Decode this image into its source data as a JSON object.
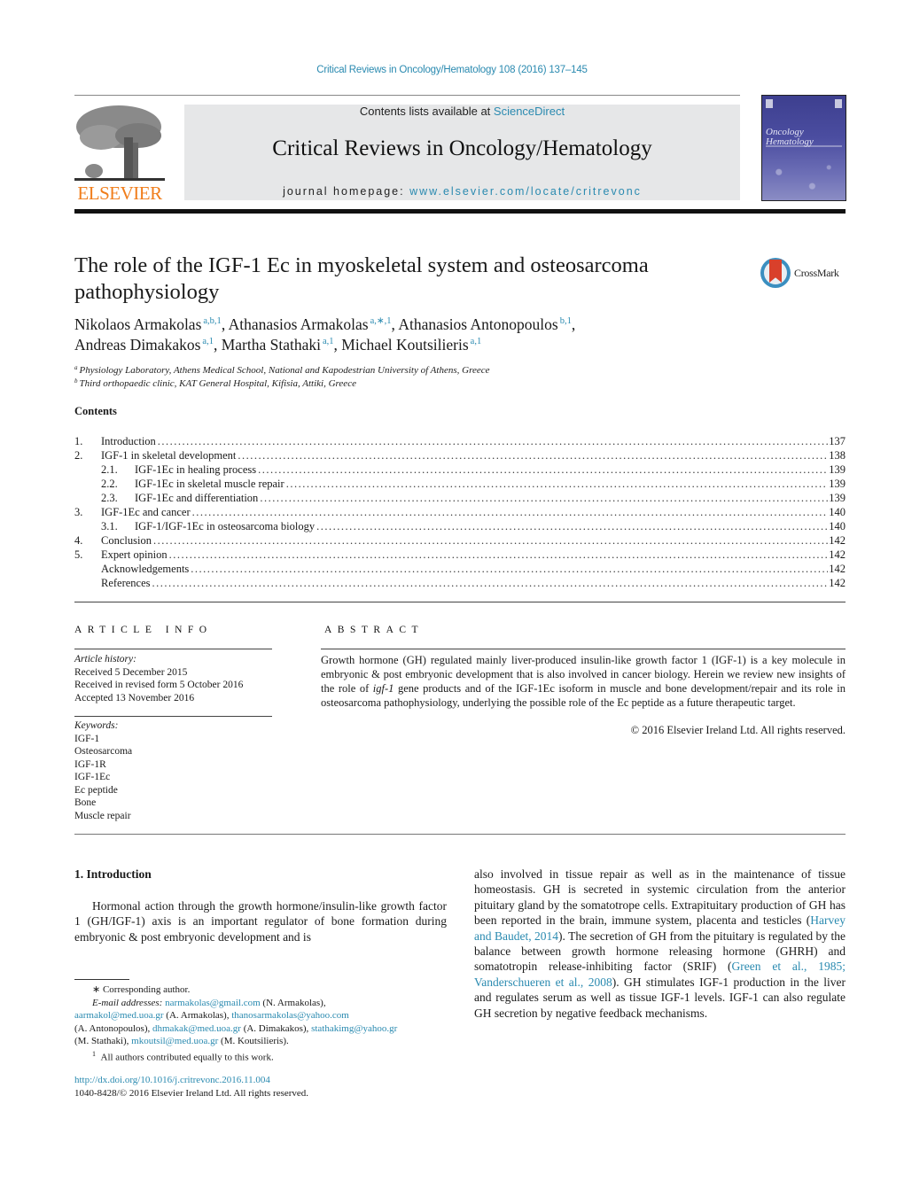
{
  "header": {
    "citation": "Critical Reviews in Oncology/Hematology 108 (2016) 137–145",
    "publisher_logo_text": "ELSEVIER",
    "contents_prefix": "Contents lists available at ",
    "contents_link": "ScienceDirect",
    "journal_title": "Critical Reviews in Oncology/Hematology",
    "homepage_prefix": "journal homepage: ",
    "homepage_link": "www.elsevier.com/locate/critrevonc",
    "cover_title": "Oncology Hematology",
    "colors": {
      "link": "#2a8ab0",
      "elsevier_orange": "#f07d1b",
      "banner_bg": "#e6e7e8",
      "cover": "#4b4da0"
    }
  },
  "article": {
    "title": "The role of the IGF-1 Ec in myoskeletal system and osteosarcoma pathophysiology",
    "crossmark_label": "CrossMark",
    "authors": [
      {
        "name": "Nikolaos Armakolas",
        "sup": "a,b,1",
        "sep": ", "
      },
      {
        "name": "Athanasios Armakolas",
        "sup": "a,∗,1",
        "sep": ", "
      },
      {
        "name": "Athanasios Antonopoulos",
        "sup": "b,1",
        "sep": ","
      },
      {
        "name": "Andreas Dimakakos",
        "sup": "a,1",
        "sep": ", "
      },
      {
        "name": "Martha Stathaki",
        "sup": "a,1",
        "sep": ", "
      },
      {
        "name": "Michael Koutsilieris",
        "sup": "a,1",
        "sep": ""
      }
    ],
    "affiliations": [
      {
        "mark": "a",
        "text": "Physiology Laboratory, Athens Medical School, National and Kapodestrian University of Athens, Greece"
      },
      {
        "mark": "b",
        "text": "Third orthopaedic clinic, KAT General Hospital, Kifisia, Attiki, Greece"
      }
    ]
  },
  "contents": {
    "heading": "Contents",
    "items": [
      {
        "num": "1.",
        "label": "Introduction",
        "page": "137",
        "level": 1
      },
      {
        "num": "2.",
        "label": "IGF-1 in skeletal development",
        "page": "138",
        "level": 1
      },
      {
        "num": "2.1.",
        "label": "IGF-1Ec in healing process",
        "page": "139",
        "level": 2
      },
      {
        "num": "2.2.",
        "label": "IGF-1Ec in skeletal muscle repair",
        "page": "139",
        "level": 2
      },
      {
        "num": "2.3.",
        "label": "IGF-1Ec and differentiation",
        "page": "139",
        "level": 2
      },
      {
        "num": "3.",
        "label": "IGF-1Ec and cancer",
        "page": "140",
        "level": 1
      },
      {
        "num": "3.1.",
        "label": "IGF-1/IGF-1Ec in osteosarcoma biology",
        "page": "140",
        "level": 2
      },
      {
        "num": "4.",
        "label": "Conclusion",
        "page": "142",
        "level": 1
      },
      {
        "num": "5.",
        "label": "Expert opinion",
        "page": "142",
        "level": 1
      },
      {
        "num": "",
        "label": "Acknowledgements",
        "page": "142",
        "level": 1
      },
      {
        "num": "",
        "label": "References",
        "page": "142",
        "level": 1
      }
    ]
  },
  "article_info": {
    "heading": "ARTICLE INFO",
    "history_label": "Article history:",
    "history": [
      "Received 5 December 2015",
      "Received in revised form 5 October 2016",
      "Accepted 13 November 2016"
    ],
    "keywords_label": "Keywords:",
    "keywords": [
      "IGF-1",
      "Osteosarcoma",
      "IGF-1R",
      "IGF-1Ec",
      "Ec peptide",
      "Bone",
      "Muscle repair"
    ]
  },
  "abstract": {
    "heading": "ABSTRACT",
    "text_before": "Growth hormone (GH) regulated mainly liver-produced insulin-like growth factor 1 (IGF-1) is a key molecule in embryonic & post embryonic development that is also involved in cancer biology. Herein we review new insights of the role of ",
    "text_italic": "igf-1",
    "text_after": " gene products and of the IGF-1Ec isoform in muscle and bone development/repair and its role in osteosarcoma pathophysiology, underlying the possible role of the Ec peptide as a future therapeutic target.",
    "copyright": "© 2016 Elsevier Ireland Ltd. All rights reserved."
  },
  "body": {
    "section_heading": "1.  Introduction",
    "left_para": "Hormonal action through the growth hormone/insulin-like growth factor 1 (GH/IGF-1) axis is an important regulator of bone formation during embryonic & post embryonic development and is",
    "right": {
      "p1": "also involved in tissue repair as well as in the maintenance of tissue homeostasis. GH is secreted in systemic circulation from the anterior pituitary gland by the somatotrope cells. Extrapituitary production of GH has been reported in the brain, immune system, placenta and testicles (",
      "ref1": "Harvey and Baudet, 2014",
      "p2": "). The secretion of GH from the pituitary is regulated by the balance between growth hormone releasing hormone (GHRH) and somatotropin release-inhibiting factor (SRIF) (",
      "ref2": "Green et al., 1985; Vanderschueren et al., 2008",
      "p3": "). GH stimulates IGF-1 production in the liver and regulates serum as well as tissue IGF-1 levels. IGF-1 can also regulate GH secretion by negative feedback mechanisms."
    }
  },
  "footnotes": {
    "corresponding": "∗  Corresponding author.",
    "email_label": "E-mail addresses:",
    "emails": [
      {
        "email": "narmakolas@gmail.com",
        "who": " (N. Armakolas), "
      },
      {
        "email": "aarmakol@med.uoa.gr",
        "who": " (A. Armakolas), "
      },
      {
        "email": "thanosarmakolas@yahoo.com",
        "who": " (A. Antonopoulos), "
      },
      {
        "email": "dhmakak@med.uoa.gr",
        "who": " (A. Dimakakos), "
      },
      {
        "email": "stathakimg@yahoo.gr",
        "who": " (M. Stathaki), "
      },
      {
        "email": "mkoutsil@med.uoa.gr",
        "who": " (M. Koutsilieris)."
      }
    ],
    "equal_mark": "1",
    "equal_text": "All authors contributed equally to this work.",
    "doi": "http://dx.doi.org/10.1016/j.critrevonc.2016.11.004",
    "issn": "1040-8428/© 2016 Elsevier Ireland Ltd. All rights reserved."
  }
}
